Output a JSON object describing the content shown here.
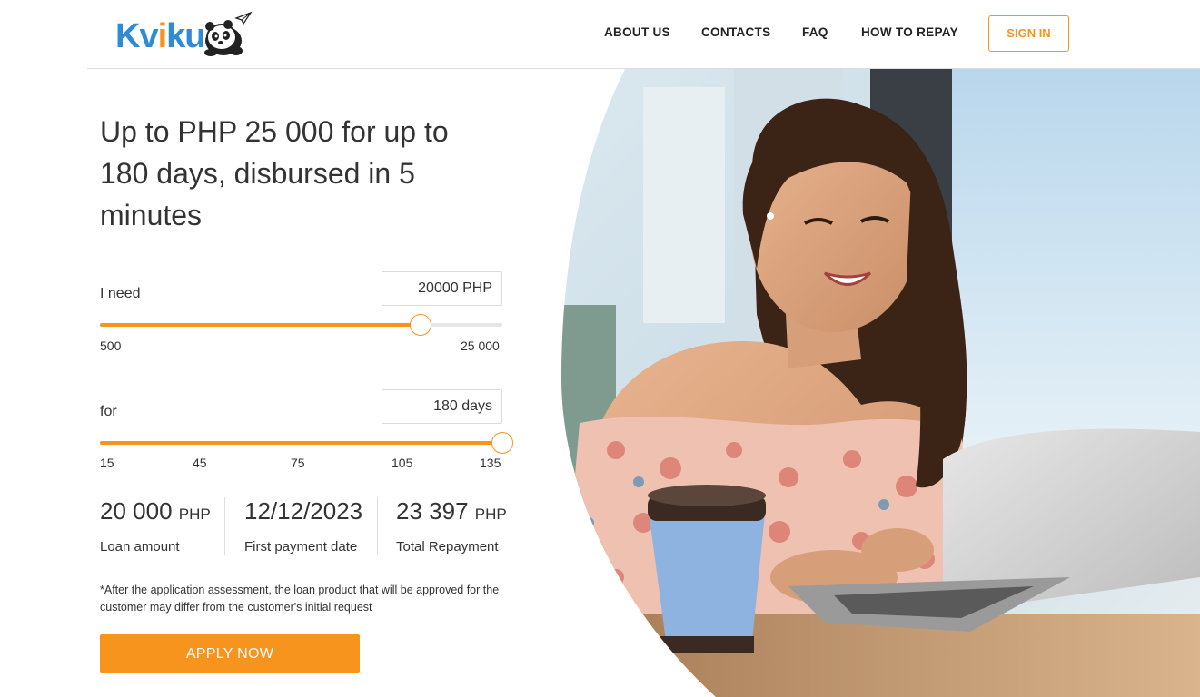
{
  "header": {
    "logo_text_k": "Kv",
    "logo_text_i": "i",
    "logo_text_ku": "ku",
    "nav": {
      "about": "ABOUT US",
      "contacts": "CONTACTS",
      "faq": "FAQ",
      "repay": "HOW TO REPAY"
    },
    "sign_in": "SIGN IN"
  },
  "hero": {
    "headline": "Up to PHP 25 000 for up to 180 days, disbursed in 5 minutes"
  },
  "calculator": {
    "amount": {
      "label": "I need",
      "value": "20000 PHP",
      "min_label": "500",
      "max_label": "25 000",
      "min": 500,
      "max": 25000,
      "current": 20000
    },
    "term": {
      "label": "for",
      "value": "180 days",
      "ticks": [
        "15",
        "45",
        "75",
        "105",
        "135"
      ],
      "fill_fraction": 1.0
    }
  },
  "summary": {
    "loan_amount": {
      "value": "20 000",
      "unit": "PHP",
      "label": "Loan amount"
    },
    "first_payment": {
      "value": "12/12/2023",
      "label": "First payment date"
    },
    "total_repayment": {
      "value": "23 397",
      "unit": "PHP",
      "label": "Total Repayment"
    }
  },
  "disclaimer": "*After the application assessment, the loan product that will be approved for the customer may differ from the customer's initial request",
  "apply_button": "APPLY NOW",
  "colors": {
    "accent": "#f7941d",
    "brand_blue": "#2f8bd6",
    "text": "#333333"
  }
}
